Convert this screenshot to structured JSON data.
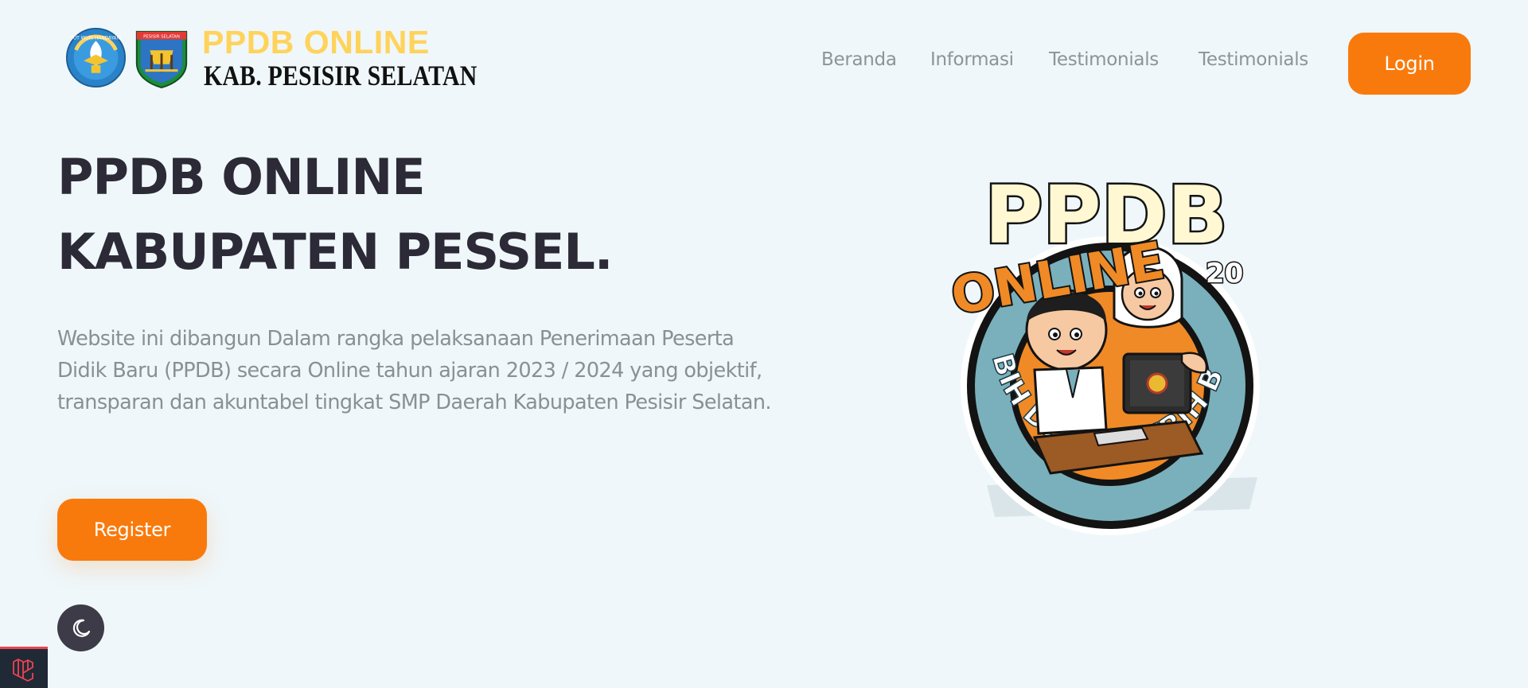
{
  "brand": {
    "title": "PPDB ONLINE",
    "subtitle": "KAB. PESISIR SELATAN",
    "emblem_left_text": "TUT WURI HANDAYANI",
    "emblem_right_text": "PESISIR SELATAN"
  },
  "nav": {
    "items": [
      {
        "label": "Beranda"
      },
      {
        "label": "Informasi"
      },
      {
        "label": "Testimonials"
      },
      {
        "label": "Testimonials"
      }
    ],
    "login_label": "Login"
  },
  "hero": {
    "title_line1": "PPDB ONLINE",
    "title_line2": "KABUPATEN PESSEL.",
    "description": "Website ini dibangun Dalam rangka pelaksanaan Penerimaan Peserta Didik Baru (PPDB) secara Online tahun ajaran 2023 / 2024 yang objektif, transparan dan akuntabel tingkat SMP Daerah Kabupaten Pesisir Selatan.",
    "register_label": "Register"
  },
  "illustration": {
    "top_text": "PPDB",
    "banner_text": "ONLINE",
    "year_text": "20",
    "ring_text": "LEBIH DEKAT, LEBIH BAIK"
  },
  "icons": {
    "theme_toggle": "moon-icon",
    "debug_badge": "laravel-icon"
  },
  "colors": {
    "accent": "#f97a0c",
    "background": "#eff7fa",
    "heading": "#2b2a36",
    "muted_text": "#8a8f96",
    "brand_yellow": "#ffd35b"
  }
}
